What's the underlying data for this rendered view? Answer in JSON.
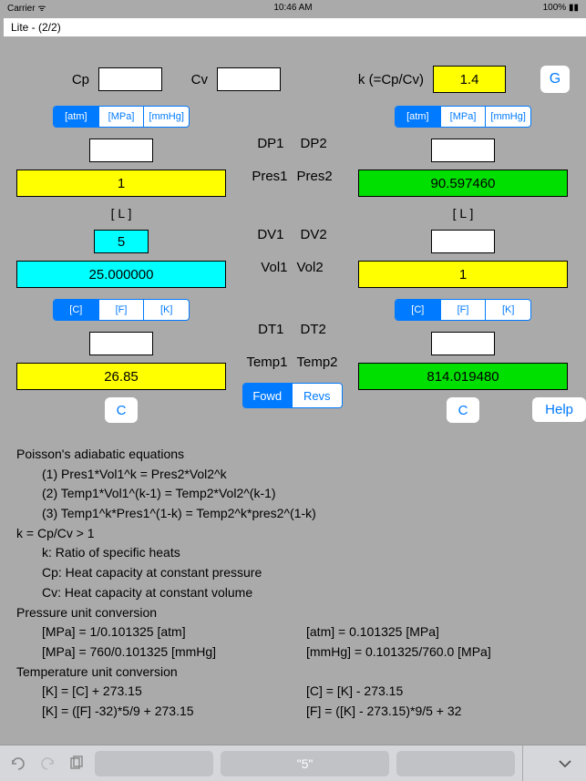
{
  "status": {
    "carrier": "Carrier",
    "wifi": "≈",
    "time": "10:46 AM",
    "battery": "100%"
  },
  "title": "Lite - (2/2)",
  "top": {
    "cp_label": "Cp",
    "cp_value": "",
    "cv_label": "Cv",
    "cv_value": "",
    "k_label": "k (=Cp/Cv)",
    "k_value": "1.4",
    "g_label": "G"
  },
  "pressure_units": [
    "[atm]",
    "[MPa]",
    "[mmHg]"
  ],
  "temp_units": [
    "[C]",
    "[F]",
    "[K]"
  ],
  "col1": {
    "dp": "",
    "pres": "1",
    "litre": "[ L ]",
    "dv": "5",
    "vol": "25.000000",
    "dt": "",
    "temp": "26.85",
    "c_label": "C"
  },
  "col2": {
    "dp": "",
    "pres": "90.597460",
    "litre": "[ L ]",
    "dv": "",
    "vol": "1",
    "dt": "",
    "temp": "814.019480",
    "c_label": "C"
  },
  "mid": {
    "dp1": "DP1",
    "dp2": "DP2",
    "pres1": "Pres1",
    "pres2": "Pres2",
    "dv1": "DV1",
    "dv2": "DV2",
    "vol1": "Vol1",
    "vol2": "Vol2",
    "dt1": "DT1",
    "dt2": "DT2",
    "temp1": "Temp1",
    "temp2": "Temp2",
    "fowd": "Fowd",
    "revs": "Revs"
  },
  "help_label": "Help",
  "eq": {
    "h1": "Poisson's adiabatic equations",
    "e1": "(1) Pres1*Vol1^k = Pres2*Vol2^k",
    "e2": "(2) Temp1*Vol1^(k-1) = Temp2*Vol2^(k-1)",
    "e3": "(3) Temp1^k*Pres1^(1-k) = Temp2^k*pres2^(1-k)",
    "h2": "k = Cp/Cv > 1",
    "k1": "k: Ratio of specific heats",
    "k2": "Cp: Heat capacity at constant pressure",
    "k3": "Cv: Heat capacity at constant volume",
    "h3": "Pressure unit conversion",
    "p1a": "[MPa] = 1/0.101325 [atm]",
    "p1b": "[atm] = 0.101325 [MPa]",
    "p2a": "[MPa] = 760/0.101325 [mmHg]",
    "p2b": "[mmHg] = 0.101325/760.0 [MPa]",
    "h4": "Temperature unit conversion",
    "t1a": "[K] = [C] + 273.15",
    "t1b": "[C] = [K] - 273.15",
    "t2a": "[K] = ([F] -32)*5/9 + 273.15",
    "t2b": "[F] = ([K] - 273.15)*9/5 + 32"
  },
  "bottom": {
    "center": "\"5\""
  }
}
